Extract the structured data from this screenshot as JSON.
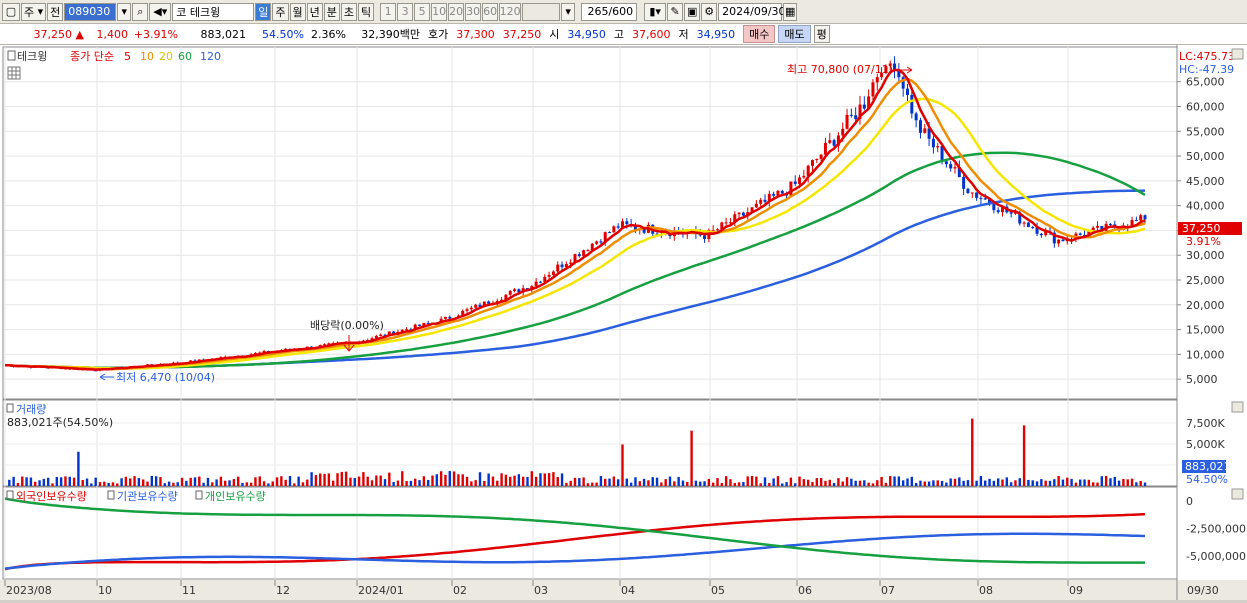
{
  "toolbar": {
    "market": "주",
    "type": "전",
    "code": "089030",
    "stock_prefix": "코",
    "stock_name": "테크윙",
    "periods": [
      "일",
      "주",
      "월",
      "년",
      "분",
      "초",
      "틱"
    ],
    "selected_period": "일",
    "minutes": [
      "1",
      "3",
      "5",
      "10",
      "20",
      "30",
      "60",
      "120"
    ],
    "count": "265/600",
    "date": "2024/09/30"
  },
  "quote": {
    "price": "37,250",
    "change": "1,400",
    "change_pct": "+3.91%",
    "volume": "883,021",
    "volume_ratio": "54.50%",
    "turnover": "2.36%",
    "amount": "32,390백만",
    "ask_label": "호가",
    "ask1": "37,300",
    "bid1": "37,250",
    "open_label": "시",
    "open": "34,950",
    "high_label": "고",
    "high": "37,600",
    "low_label": "저",
    "low": "34,950",
    "buy": "매수",
    "sell": "매도",
    "eval": "평"
  },
  "colors": {
    "up": "#e00000",
    "down": "#0033cc",
    "ma5": "#e00000",
    "ma10": "#f08c00",
    "ma20": "#f5e600",
    "ma60": "#17a040",
    "ma120": "#2a5fe0"
  },
  "price_panel": {
    "legend_name": "테크윙",
    "legend_desc": "종가 단순",
    "ma_labels": [
      "5",
      "10",
      "20",
      "60",
      "120"
    ],
    "lc_label": "LC:475.73",
    "hc_label": "HC:-47.39",
    "last_price": "37,250",
    "last_pct": "3.91%",
    "high_annotation": "최고 70,800 (07/11)",
    "low_annotation": "최저 6,470 (10/04)",
    "dividend_annotation": "배당락(0.00%)"
  },
  "volume_panel": {
    "title": "거래량",
    "value": "883,021주(54.50%)",
    "last_value": "883,021",
    "last_pct": "54.50%"
  },
  "holding_panel": {
    "foreign": "외국인보유수량",
    "institution": "기관보유수량",
    "individual": "개인보유수량"
  },
  "x_axis": {
    "labels": [
      "2023/08",
      "10",
      "11",
      "12",
      "2024/01",
      "02",
      "03",
      "04",
      "05",
      "06",
      "07",
      "08",
      "09",
      "09/30"
    ]
  },
  "chart_data": {
    "type": "candlestick",
    "y_ticks": [
      "65,000",
      "60,000",
      "55,000",
      "50,000",
      "45,000",
      "40,000",
      "35,000",
      "30,000",
      "25,000",
      "20,000",
      "15,000",
      "10,000",
      "5,000"
    ],
    "y_range": [
      1000,
      72000
    ],
    "volume_ticks": [
      "7,500K",
      "5,000K",
      "2,500K"
    ],
    "holding_ticks": [
      "0",
      "-2,500,000",
      "-5,000,000"
    ],
    "months": [
      "2023/08",
      "10",
      "11",
      "12",
      "2024/01",
      "02",
      "03",
      "04",
      "05",
      "06",
      "07",
      "08",
      "09"
    ],
    "close_by_month": [
      7800,
      6900,
      8300,
      10500,
      12500,
      17000,
      24000,
      36000,
      34000,
      44000,
      65000,
      43000,
      33000
    ],
    "last_close": 37250,
    "high": 70800,
    "low": 6470
  }
}
